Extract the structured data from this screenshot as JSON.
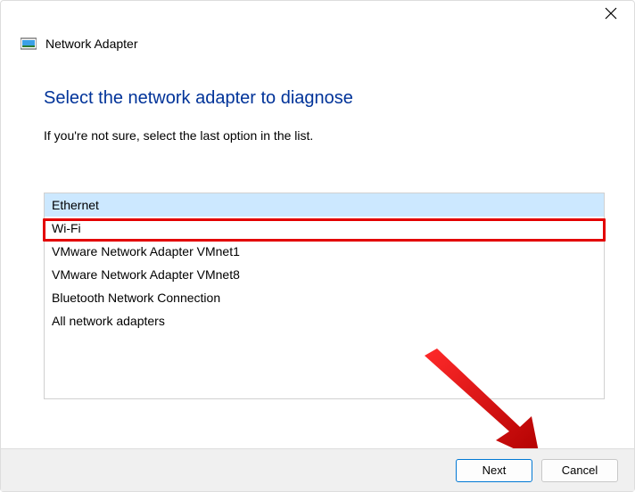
{
  "window": {
    "title": "Network Adapter"
  },
  "page": {
    "heading": "Select the network adapter to diagnose",
    "subtext": "If you're not sure, select the last option in the list."
  },
  "adapters": {
    "items": [
      "Ethernet",
      "Wi-Fi",
      "VMware Network Adapter VMnet1",
      "VMware Network Adapter VMnet8",
      "Bluetooth Network Connection",
      "All network adapters"
    ],
    "selected_index": 0
  },
  "buttons": {
    "next": "Next",
    "cancel": "Cancel"
  },
  "annotation": {
    "arrow_color": "#e30000",
    "highlight_color": "#e30000"
  }
}
